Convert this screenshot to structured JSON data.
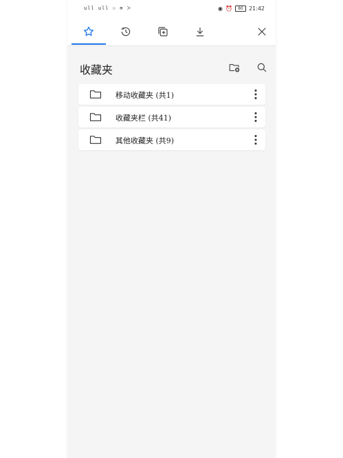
{
  "status_bar": {
    "left_text": "ull ull ☉ ⊕ ᐳ",
    "time": "21:42",
    "battery": "80"
  },
  "tabs": [
    {
      "name": "bookmarks",
      "icon": "star-icon",
      "active": true
    },
    {
      "name": "history",
      "icon": "history-icon",
      "active": false
    },
    {
      "name": "tabs",
      "icon": "add-tab-icon",
      "active": false
    },
    {
      "name": "downloads",
      "icon": "download-icon",
      "active": false
    }
  ],
  "header": {
    "title": "收藏夹"
  },
  "folders": [
    {
      "label": "移动收藏夹 (共1)"
    },
    {
      "label": "收藏夹栏 (共41)"
    },
    {
      "label": "其他收藏夹 (共9)"
    }
  ],
  "colors": {
    "accent": "#1a73e8",
    "background": "#f5f5f6",
    "icon": "#444444"
  }
}
